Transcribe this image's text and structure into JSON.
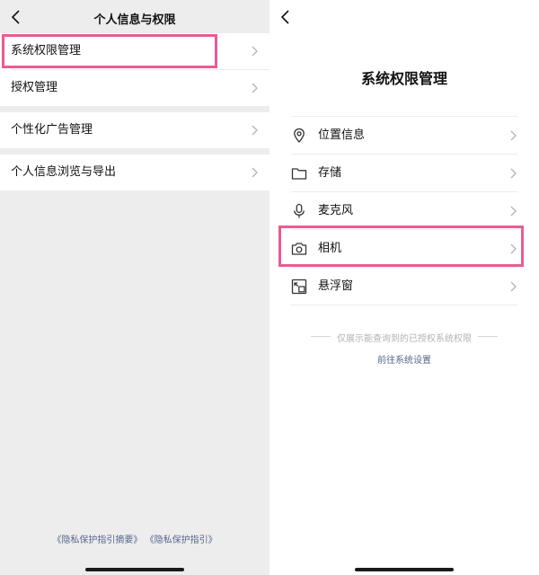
{
  "left_screen": {
    "title": "个人信息与权限",
    "items": [
      {
        "label": "系统权限管理"
      },
      {
        "label": "授权管理"
      },
      {
        "label": "个性化广告管理"
      },
      {
        "label": "个人信息浏览与导出"
      }
    ],
    "footer": {
      "link_summary": "《隐私保护指引摘要》",
      "link_full": "《隐私保护指引》"
    }
  },
  "right_screen": {
    "title": "系统权限管理",
    "permissions": [
      {
        "label": "位置信息",
        "icon": "location-pin-icon"
      },
      {
        "label": "存储",
        "icon": "folder-icon"
      },
      {
        "label": "麦克风",
        "icon": "microphone-icon"
      },
      {
        "label": "相机",
        "icon": "camera-icon"
      },
      {
        "label": "悬浮窗",
        "icon": "floating-window-icon"
      }
    ],
    "note": "仅展示能查询到的已授权系统权限",
    "settings_link": "前往系统设置"
  },
  "colors": {
    "highlight": "#ea5c93",
    "link": "#57678c",
    "background_gray": "#ededed"
  }
}
